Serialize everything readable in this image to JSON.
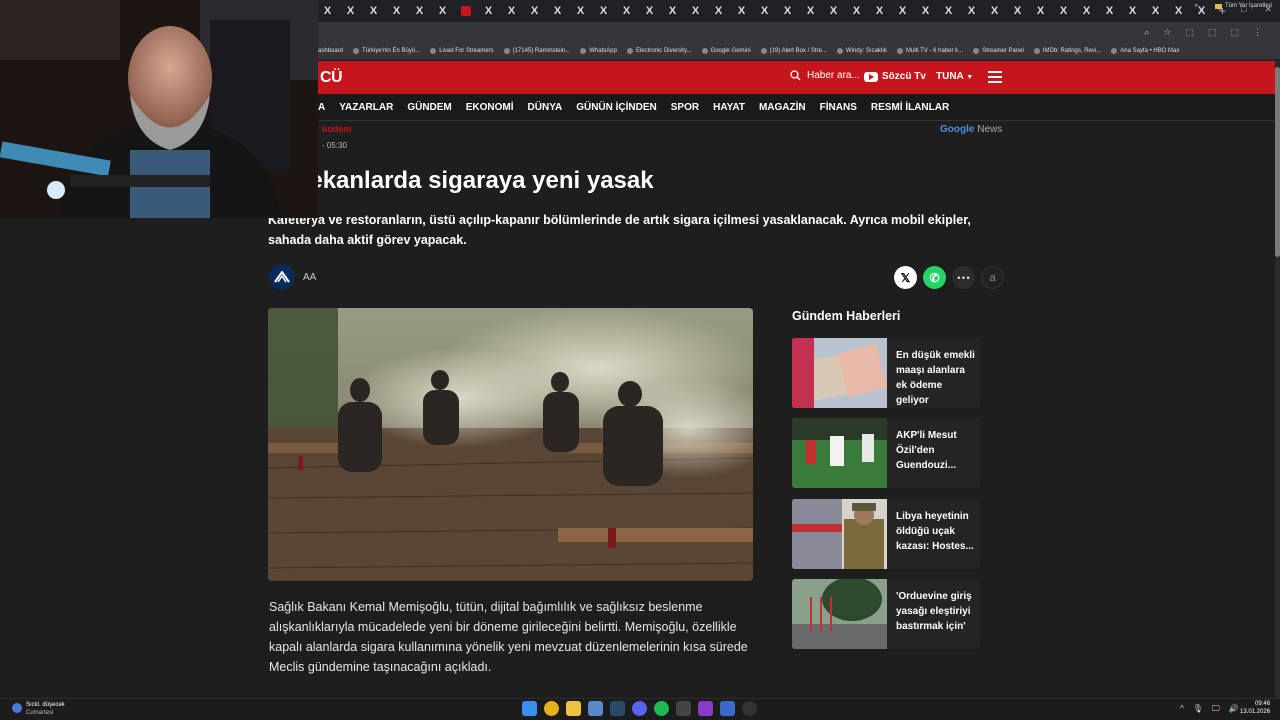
{
  "browser": {
    "tabs": [
      "X",
      "X",
      "X",
      "X",
      "X",
      "X",
      "",
      "X",
      "X",
      "X",
      "X",
      "X",
      "X",
      "X",
      "X",
      "X",
      "X",
      "X",
      "X",
      "X",
      "X",
      "X",
      "X",
      "X",
      "X",
      "X",
      "X",
      "X",
      "X",
      "X",
      "X",
      "X",
      "X",
      "X",
      "X",
      "X",
      "X",
      "X",
      "X"
    ],
    "active_tab_color": "#c4161c",
    "new_tab_label": "+",
    "window_controls": [
      "–",
      "□",
      "✕"
    ],
    "address_icons": [
      "⌕",
      "☆",
      "⬚",
      "⬚",
      "⬚",
      "⋮"
    ]
  },
  "bookmarks": {
    "items": [
      "ashboard",
      "Türkiye'nin En Büyü...",
      "Livad For Streamers",
      "(17145) Rammstein...",
      "WhatsApp",
      "Electronic Diversity...",
      "Google Gemini",
      "(19) Alert Box / Stre...",
      "Windy: Sıcaklık",
      "Multi TV - 6 haber k...",
      "Streamer Panel",
      "IMDb: Ratings, Revi...",
      "Ana Sayfa • HBO Max"
    ],
    "overflow": "»",
    "all_bookmarks": "Tüm Yer İşaretleri"
  },
  "site": {
    "logo": "CÜ",
    "brand_color": "#c4161c",
    "search_placeholder": "Haber ara...",
    "tv_link": "Sözcü Tv",
    "user": "TUNA",
    "nav": [
      "A",
      "YAZARLAR",
      "GÜNDEM",
      "EKONOMİ",
      "DÜNYA",
      "GÜNÜN İÇİNDEN",
      "SPOR",
      "HAYAT",
      "MAGAZİN",
      "FİNANS",
      "RESMİ İLANLAR"
    ]
  },
  "article": {
    "category": "ündem",
    "timestamp": "- 05:30",
    "google_news_g": "Google",
    "google_news_n": " News",
    "headline": "lı mekanlarda sigaraya yeni yasak",
    "summary": "Kafeterya ve restoranların, üstü açılıp-kapanır bölümlerinde de artık sigara içilmesi yasaklanacak. Ayrıca mobil ekipler, sahada daha aktif görev yapacak.",
    "source": "AA",
    "share": {
      "x": "𝕏",
      "whatsapp": "✆",
      "more": "⋯",
      "font": "a"
    },
    "body": "Sağlık Bakanı Kemal Memişoğlu, tütün, dijital bağımlılık ve sağlıksız beslenme alışkanlıklarıyla mücadelede yeni bir döneme girileceğini belirtti. Memişoğlu, özellikle kapalı alanlarda sigara kullanımına yönelik yeni mevzuat düzenlemelerinin kısa sürede Meclis gündemine taşınacağını açıkladı."
  },
  "sidebar": {
    "title": "Gündem Haberleri",
    "items": [
      {
        "title": "En düşük emekli maaşı alanlara ek ödeme geliyor"
      },
      {
        "title": "AKP'li Mesut Özil'den Guendouzi..."
      },
      {
        "title": "Libya heyetinin öldüğü uçak kazası: Hostes..."
      },
      {
        "title": "'Orduevine giriş yasağı eleştiriyi bastırmak için'"
      }
    ]
  },
  "taskbar": {
    "weather_line1": "Sıckl. düşecek",
    "weather_line2": "Cumartesi",
    "tray": [
      "^",
      "🎙",
      "🖵",
      "🔊"
    ],
    "time": "09:46",
    "date": "13.01.2026"
  }
}
